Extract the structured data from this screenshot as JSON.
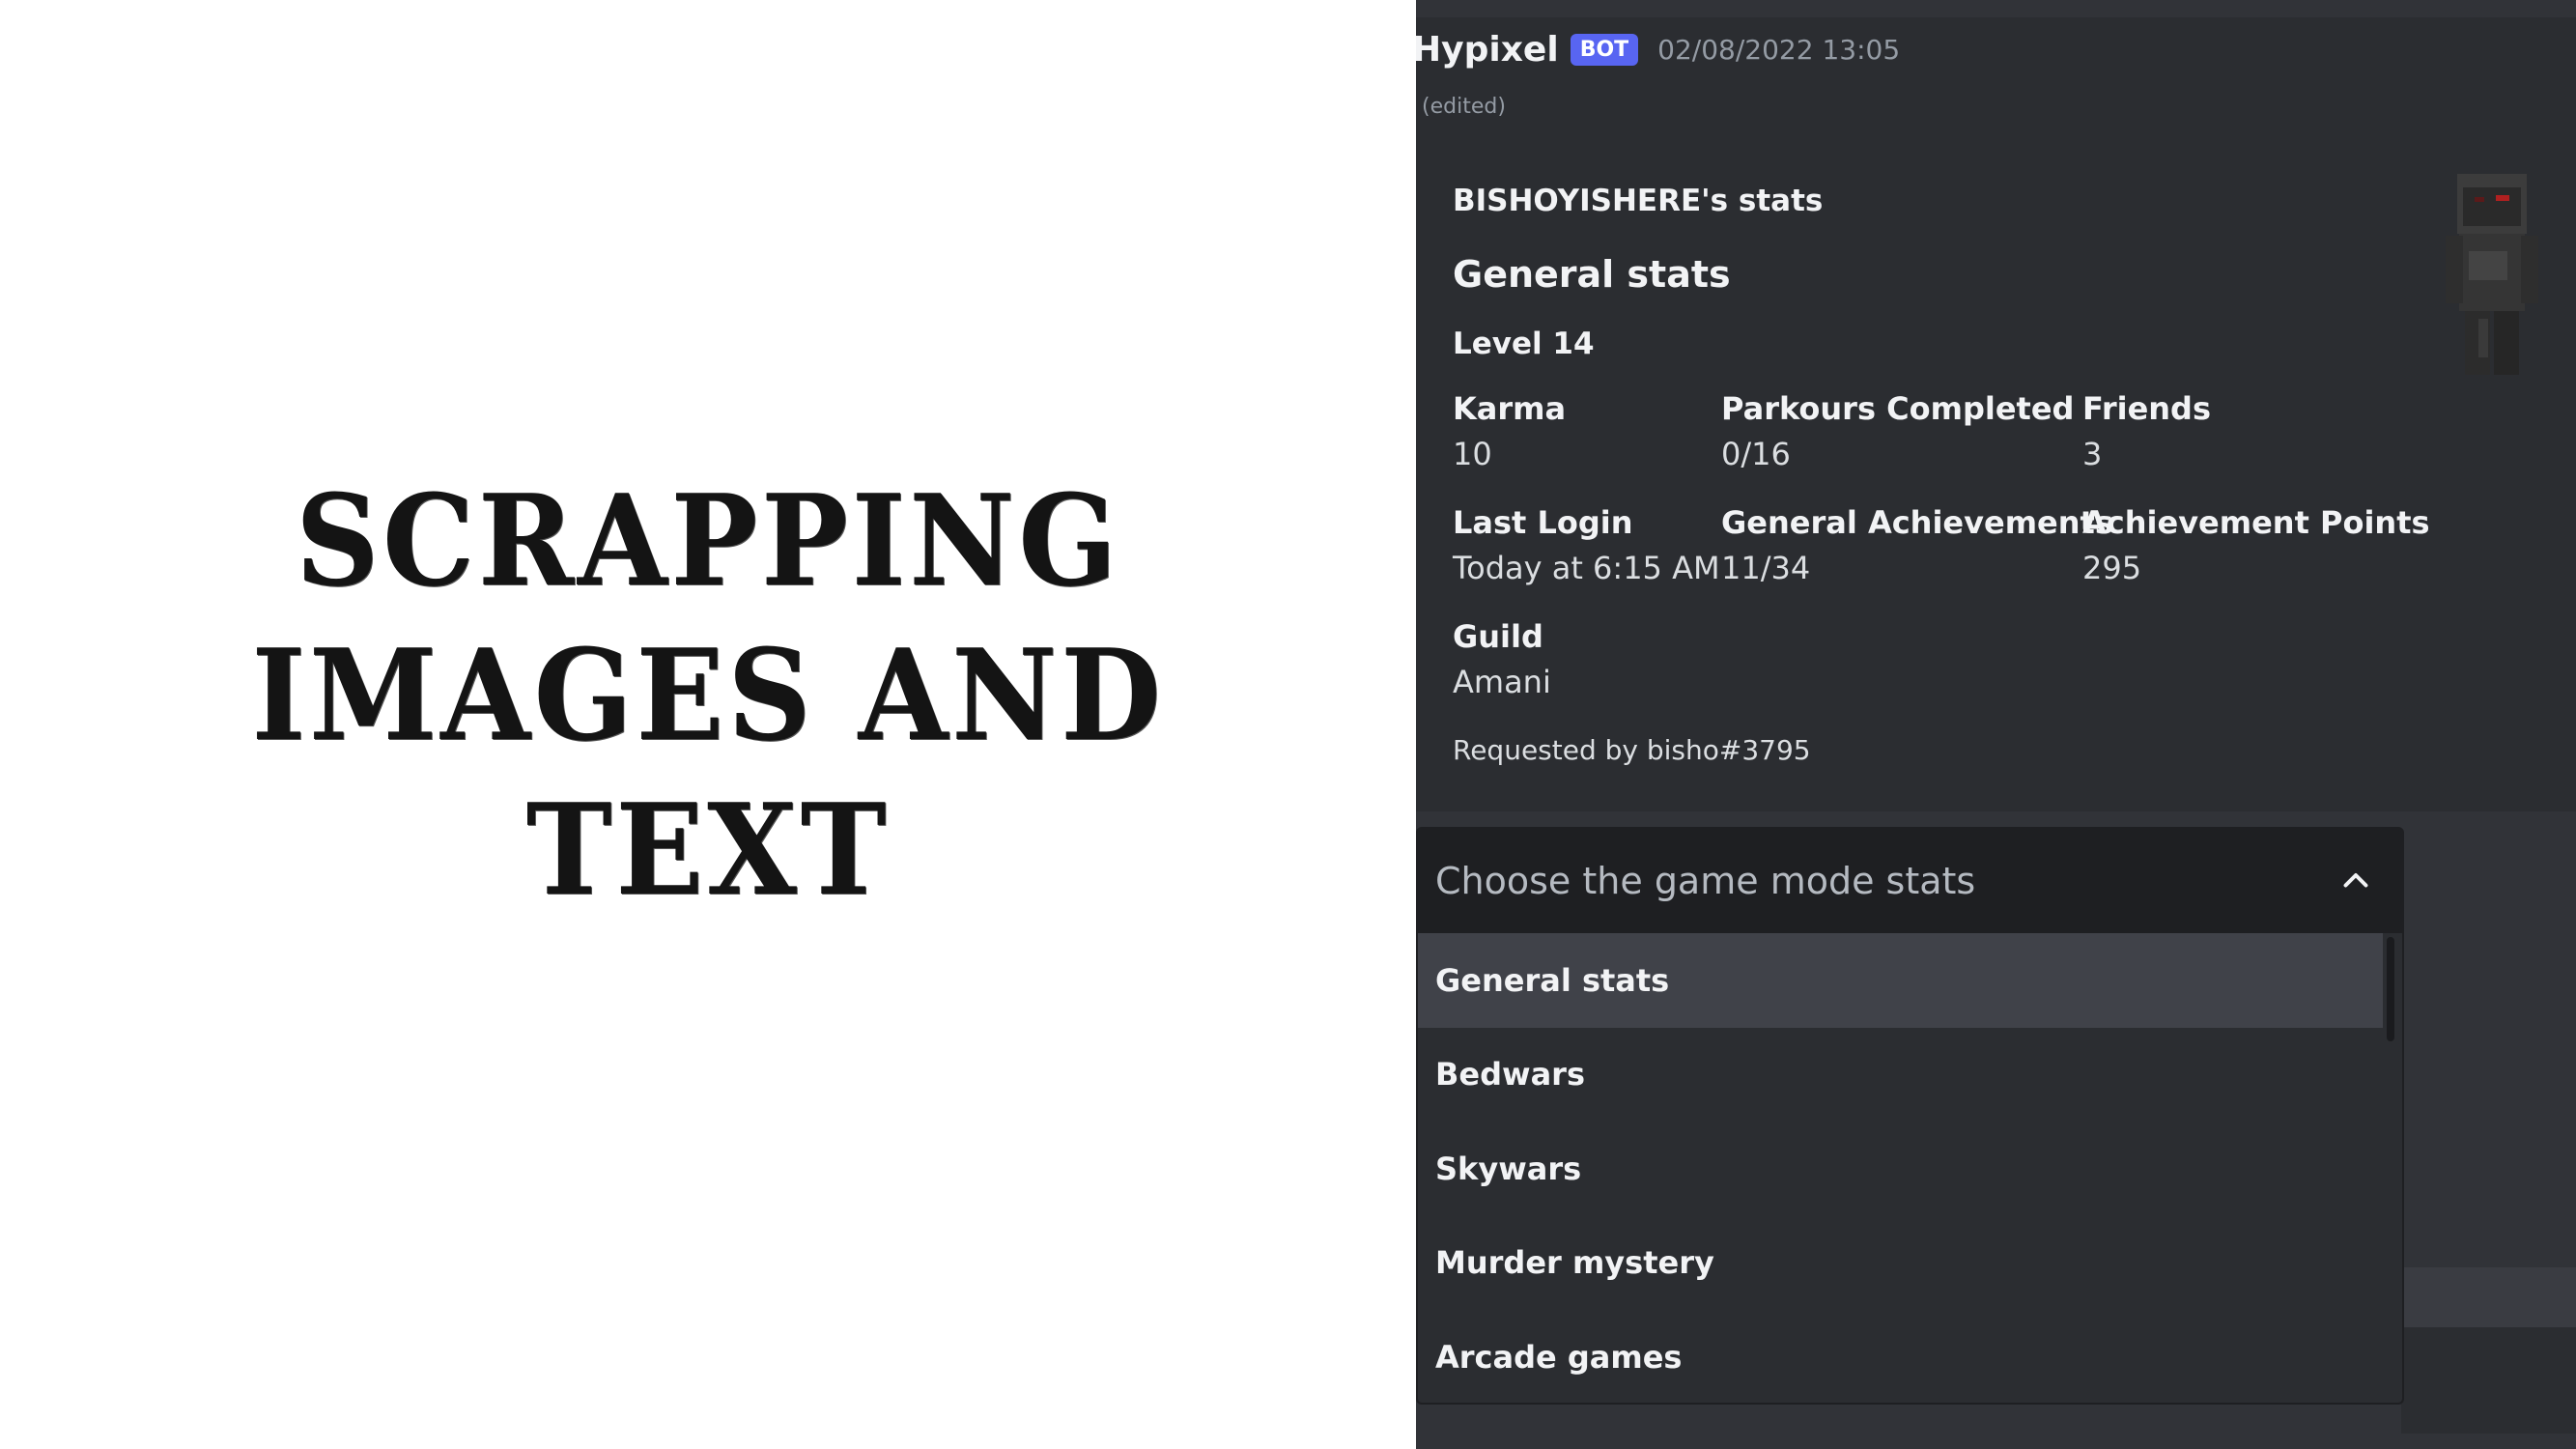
{
  "slide_title": {
    "line1": "SCRAPPING IMAGES AND",
    "line2": "TEXT"
  },
  "message": {
    "author": "Hypixel",
    "badge": "BOT",
    "timestamp": "02/08/2022 13:05",
    "edited": "(edited)"
  },
  "embed": {
    "title": "BISHOYISHERE's stats",
    "section": "General stats",
    "level": "Level 14",
    "fields": [
      {
        "name": "Karma",
        "value": "10"
      },
      {
        "name": "Parkours Completed",
        "value": "0/16"
      },
      {
        "name": "Friends",
        "value": "3"
      },
      {
        "name": "Last Login",
        "value": "Today at 6:15 AM"
      },
      {
        "name": "General Achievements",
        "value": "11/34"
      },
      {
        "name": "Achievement Points",
        "value": "295"
      },
      {
        "name": "Guild",
        "value": "Amani"
      }
    ],
    "footer": "Requested by bisho#3795"
  },
  "select_menu": {
    "placeholder": "Choose the game mode stats",
    "options": [
      "General stats",
      "Bedwars",
      "Skywars",
      "Murder mystery",
      "Arcade games"
    ],
    "selected_index": 0,
    "icon": "chevron-up-icon"
  },
  "colors": {
    "panel_bg": "#2b2d31",
    "badge": "#5865f2",
    "select_head": "#1e1f22",
    "selected_option": "#404249"
  }
}
